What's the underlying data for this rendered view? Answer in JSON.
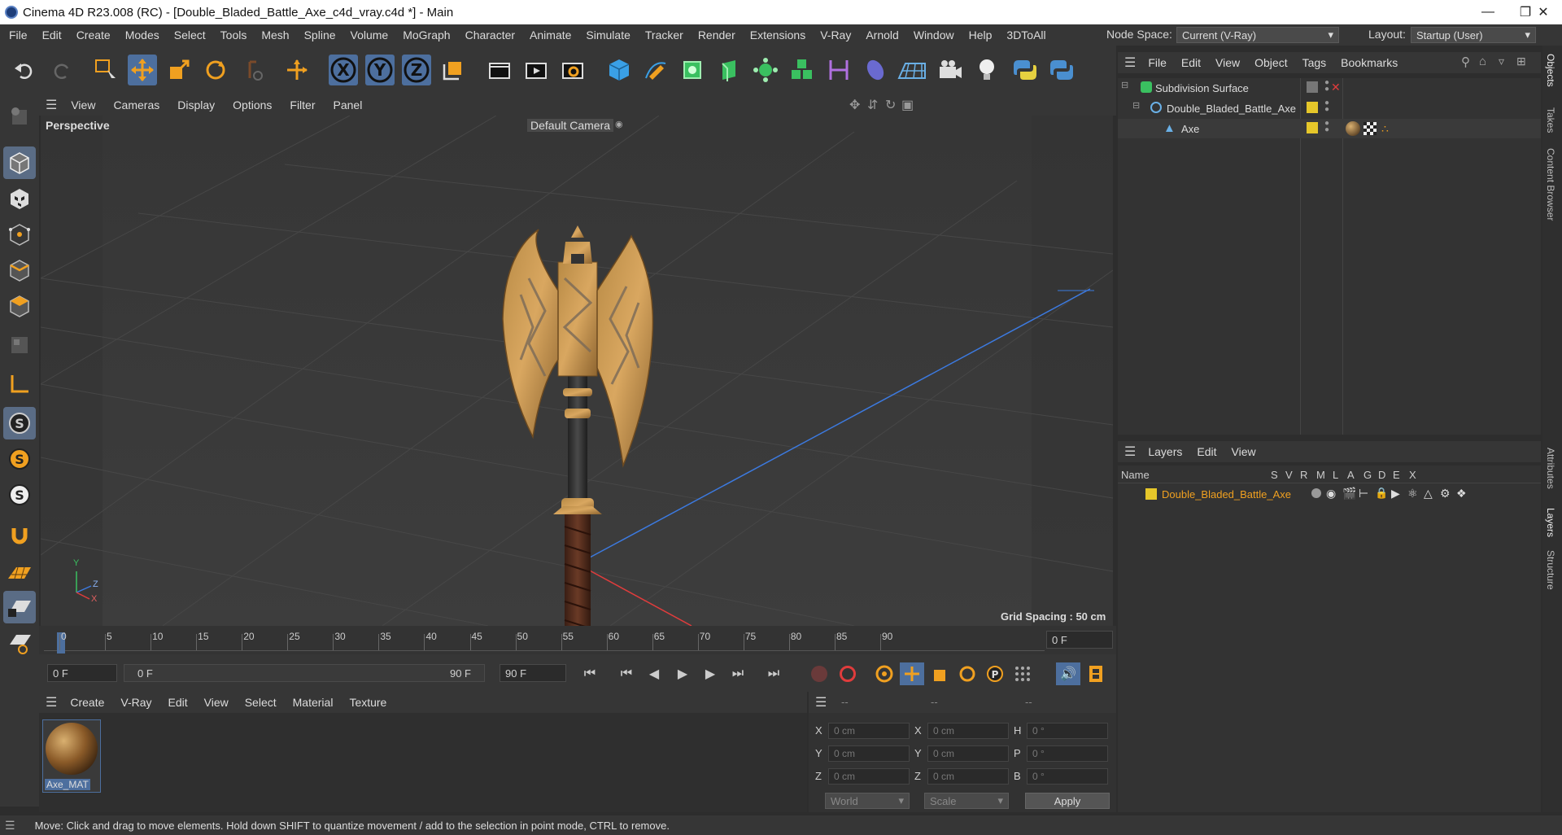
{
  "window": {
    "title": "Cinema 4D R23.008 (RC) - [Double_Bladed_Battle_Axe_c4d_vray.c4d *] - Main"
  },
  "menu": [
    "File",
    "Edit",
    "Create",
    "Modes",
    "Select",
    "Tools",
    "Mesh",
    "Spline",
    "Volume",
    "MoGraph",
    "Character",
    "Animate",
    "Simulate",
    "Tracker",
    "Render",
    "Extensions",
    "V-Ray",
    "Arnold",
    "Window",
    "Help",
    "3DToAll"
  ],
  "node_space": {
    "label": "Node Space:",
    "value": "Current (V-Ray)"
  },
  "layout": {
    "label": "Layout:",
    "value": "Startup (User)"
  },
  "axis_buttons": [
    "X",
    "Y",
    "Z"
  ],
  "viewport": {
    "menu": [
      "View",
      "Cameras",
      "Display",
      "Options",
      "Filter",
      "Panel"
    ],
    "label": "Perspective",
    "camera": "Default Camera",
    "grid_spacing": "Grid Spacing : 50 cm",
    "axis": {
      "y": "Y",
      "z": "Z",
      "x": "X"
    }
  },
  "timeline": {
    "ticks": [
      "0",
      "5",
      "10",
      "15",
      "20",
      "25",
      "30",
      "35",
      "40",
      "45",
      "50",
      "55",
      "60",
      "65",
      "70",
      "75",
      "80",
      "85",
      "90"
    ],
    "current_frame": "0 F",
    "start": "0 F",
    "range_start": "0 F",
    "range_end": "90 F",
    "end": "90 F"
  },
  "materials": {
    "menu": [
      "Create",
      "V-Ray",
      "Edit",
      "View",
      "Select",
      "Material",
      "Texture"
    ],
    "items": [
      {
        "name": "Axe_MAT"
      }
    ]
  },
  "coords": {
    "headers": [
      "--",
      "--",
      "--"
    ],
    "rows": [
      {
        "l1": "X",
        "v1": "0 cm",
        "l2": "X",
        "v2": "0 cm",
        "l3": "H",
        "v3": "0 °"
      },
      {
        "l1": "Y",
        "v1": "0 cm",
        "l2": "Y",
        "v2": "0 cm",
        "l3": "P",
        "v3": "0 °"
      },
      {
        "l1": "Z",
        "v1": "0 cm",
        "l2": "Z",
        "v2": "0 cm",
        "l3": "B",
        "v3": "0 °"
      }
    ],
    "mode": "World",
    "scale": "Scale",
    "apply": "Apply"
  },
  "objects": {
    "menu": [
      "File",
      "Edit",
      "View",
      "Object",
      "Tags",
      "Bookmarks"
    ],
    "tree": [
      {
        "name": "Subdivision Surface"
      },
      {
        "name": "Double_Bladed_Battle_Axe"
      },
      {
        "name": "Axe"
      }
    ]
  },
  "layers": {
    "menu": [
      "Layers",
      "Edit",
      "View"
    ],
    "columns": [
      "Name",
      "S",
      "V",
      "R",
      "M",
      "L",
      "A",
      "G",
      "D",
      "E",
      "X"
    ],
    "items": [
      {
        "name": "Double_Bladed_Battle_Axe",
        "color": "#e6c72a"
      }
    ]
  },
  "side_tabs": [
    "Objects",
    "Takes",
    "Content Browser",
    "Attributes",
    "Layers",
    "Structure"
  ],
  "status": "Move: Click and drag to move elements. Hold down SHIFT to quantize movement / add to the selection in point mode, CTRL to remove.",
  "colors": {
    "accent": "#4d6f9e",
    "layer": "#e6c72a",
    "x_axis": "#e03c3c",
    "z_axis": "#3c7ae0"
  }
}
